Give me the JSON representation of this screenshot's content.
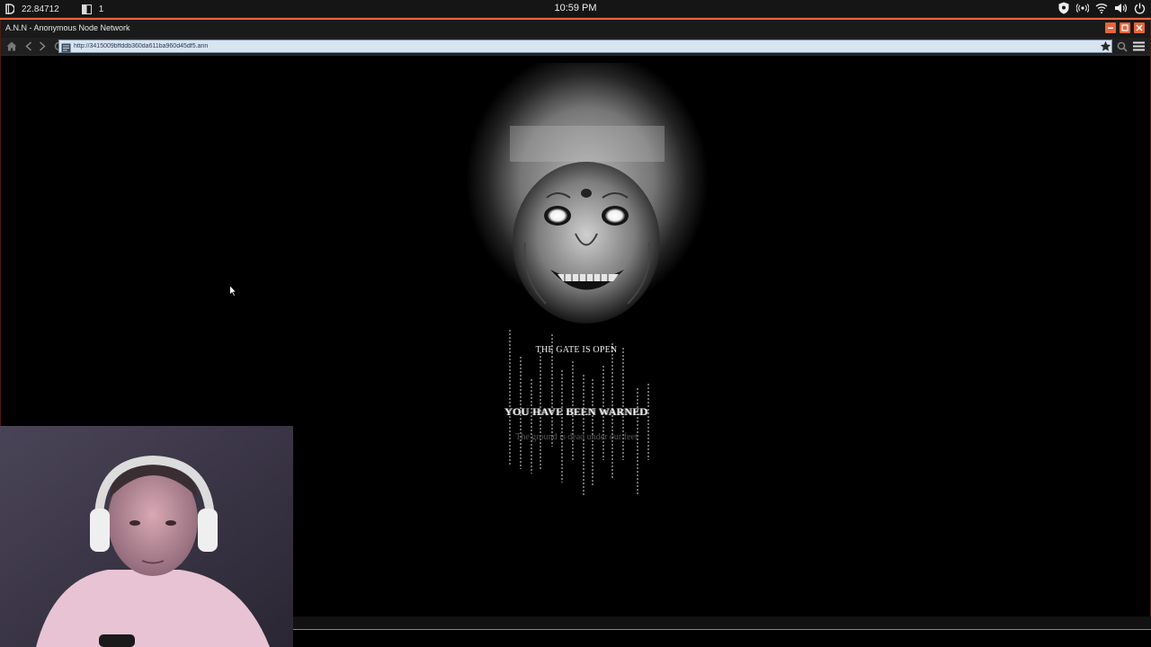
{
  "os_bar": {
    "balance": "22.84712",
    "notes_count": "1",
    "clock": "10:59 PM",
    "icons": [
      "shield-icon",
      "radio-icon",
      "wifi-icon",
      "volume-icon",
      "power-icon"
    ]
  },
  "window": {
    "title": "A.N.N - Anonymous Node Network",
    "accent_color": "#e8643a"
  },
  "browser": {
    "url": "http://3415009bffddb360da611ba960d45df5.ann",
    "nav_icons": [
      "home-icon",
      "back-icon",
      "forward-icon",
      "refresh-icon"
    ],
    "right_icons": [
      "search-icon",
      "menu-icon"
    ]
  },
  "page": {
    "gate_text": "THE GATE IS OPEN",
    "warning_text": "YOU HAVE BEEN WARNED",
    "ground_text": "The ground is dead under our feet"
  }
}
